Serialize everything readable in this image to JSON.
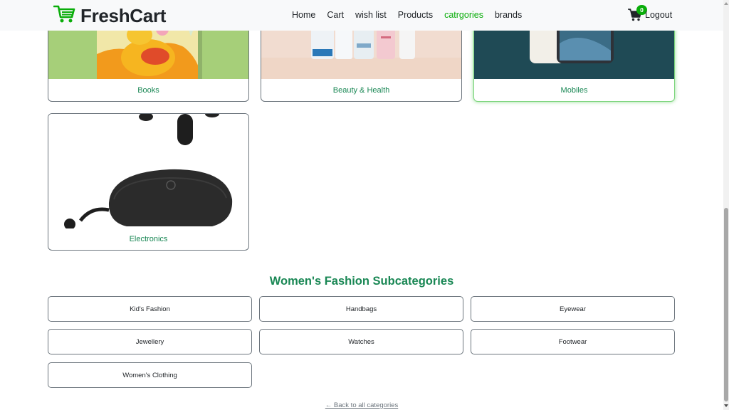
{
  "navbar": {
    "brand": "FreshCart",
    "links": [
      "Home",
      "Cart",
      "wish list",
      "Products",
      "catrgories",
      "brands"
    ],
    "active_link": "catrgories",
    "cart_count": "0",
    "logout": "Logout"
  },
  "categories": [
    {
      "name": "Books"
    },
    {
      "name": "Beauty & Health"
    },
    {
      "name": "Mobiles"
    },
    {
      "name": "Electronics"
    }
  ],
  "subcategories": {
    "title": "Women's Fashion Subcategories",
    "items": [
      "Kid's Fashion",
      "Handbags",
      "Eyewear",
      "Jewellery",
      "Watches",
      "Footwear",
      "Women's Clothing"
    ],
    "back_link": "← Back to all categories"
  },
  "colors": {
    "accent": "#0aad0a",
    "label_green": "#198754",
    "navbar_bg": "#f8f9fa"
  },
  "icons": {
    "brand": "cart-icon",
    "cart": "shopping-cart-icon"
  }
}
